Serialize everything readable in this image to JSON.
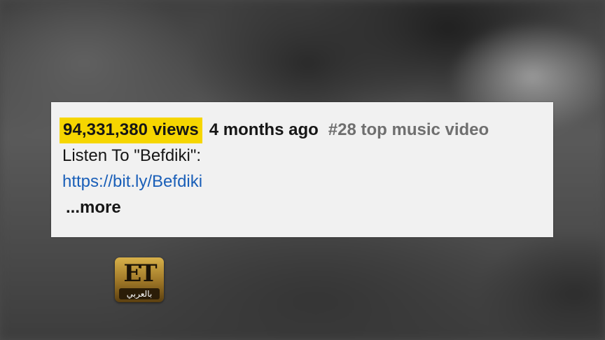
{
  "description": {
    "views": "94,331,380 views",
    "age": "4 months ago",
    "rank": "#28 top music video",
    "listen_text": "Listen To \"Befdiki\":",
    "link_text": "https://bit.ly/Befdiki",
    "more_label": "...more"
  },
  "logo": {
    "mark": "ET",
    "subtitle": "بالعربي"
  },
  "colors": {
    "views_highlight": "#f6d600",
    "link": "#1a5fb8",
    "rank_text": "#6f6f6f",
    "card_background": "#f1f1f1",
    "logo_gold": "#c9a13e"
  }
}
